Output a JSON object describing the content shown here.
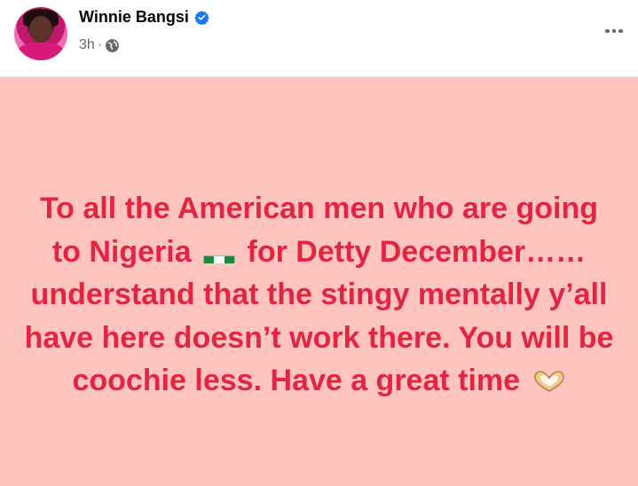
{
  "post": {
    "author_name": "Winnie Bangsi",
    "timestamp": "3h",
    "separator": "·",
    "privacy_icon": "globe-icon",
    "verified_icon": "verified-badge-icon",
    "more_icon": "more-horizontal-icon",
    "text_part1": "To all the American men who are going to Nigeria",
    "flag_icon": "nigeria-flag-emoji",
    "text_part2": "for Detty December……understand that the stingy mentally y’all have here doesn’t work there. You will be coochie less. Have a great time",
    "end_icon": "heart-hands-emoji",
    "colors": {
      "background": "#ffc4bf",
      "text": "#e32541",
      "verified": "#1877f2"
    }
  }
}
